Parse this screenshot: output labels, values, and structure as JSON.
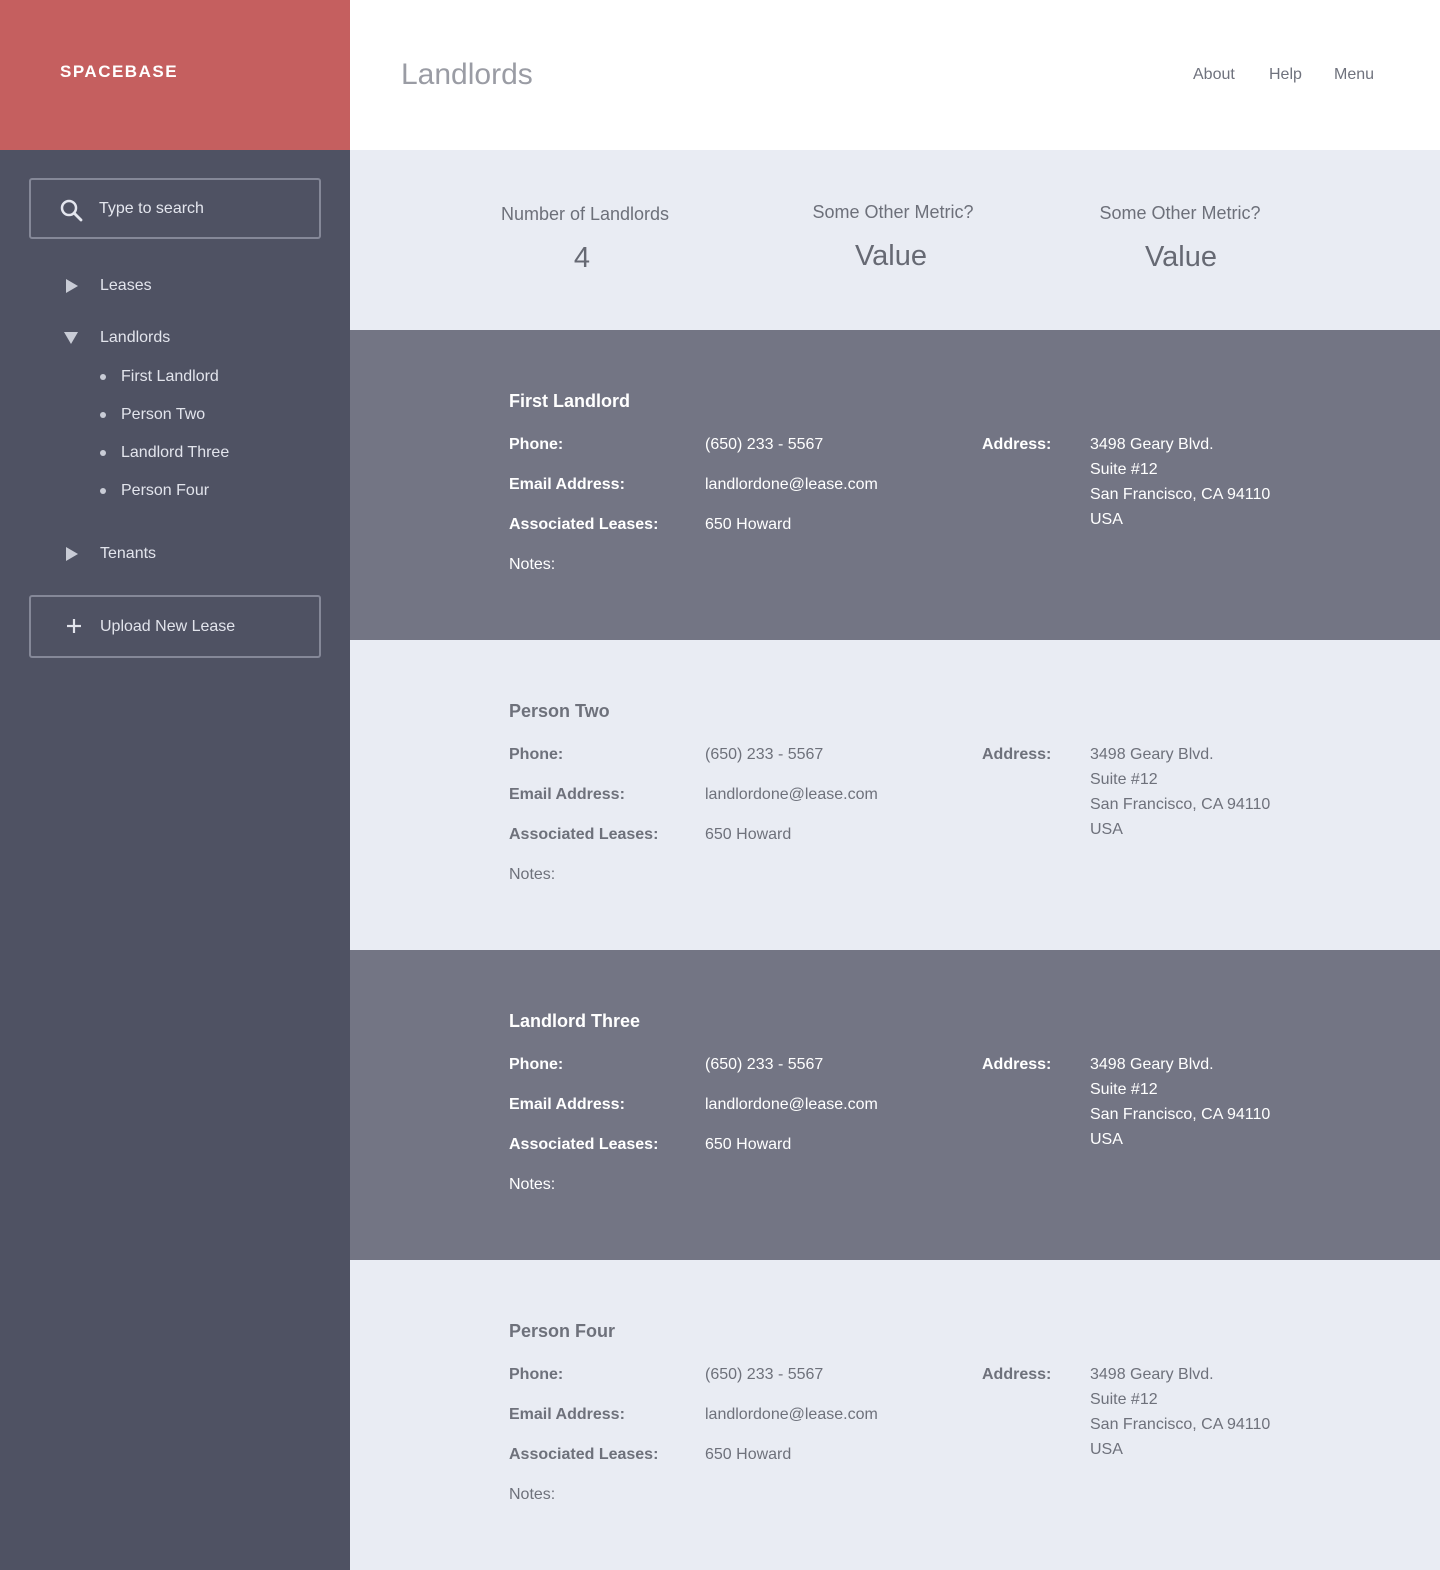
{
  "brand": {
    "name": "SPACEBASE",
    "color": "#c55f5f"
  },
  "sidebar": {
    "search_placeholder": "Type to search",
    "nav": [
      {
        "label": "Leases",
        "icon": "triangle-right-icon",
        "expanded": false
      },
      {
        "label": "Landlords",
        "icon": "triangle-down-icon",
        "expanded": true,
        "children": [
          "First Landlord",
          "Person Two",
          "Landlord Three",
          "Person Four"
        ]
      },
      {
        "label": "Tenants",
        "icon": "triangle-right-icon",
        "expanded": false
      }
    ],
    "upload_label": "Upload New Lease"
  },
  "header": {
    "title": "Landlords",
    "links": [
      "About",
      "Help",
      "Menu"
    ]
  },
  "metrics": [
    {
      "label": "Number of Landlords",
      "value": "4"
    },
    {
      "label": "Some Other Metric?",
      "value": "Value"
    },
    {
      "label": "Some Other Metric?",
      "value": "Value"
    }
  ],
  "field_labels": {
    "phone": "Phone:",
    "email": "Email Address:",
    "leases": "Associated Leases:",
    "notes": "Notes:",
    "address": "Address:"
  },
  "landlords": [
    {
      "name": "First Landlord",
      "phone": "(650) 233 - 5567",
      "email": "landlordone@lease.com",
      "leases": "650 Howard",
      "address": [
        "3498 Geary Blvd.",
        "Suite #12",
        "San Francisco, CA 94110",
        "USA"
      ]
    },
    {
      "name": "Person Two",
      "phone": "(650) 233 - 5567",
      "email": "landlordone@lease.com",
      "leases": "650 Howard",
      "address": [
        "3498 Geary Blvd.",
        "Suite #12",
        "San Francisco, CA 94110",
        "USA"
      ]
    },
    {
      "name": "Landlord Three",
      "phone": "(650) 233 - 5567",
      "email": "landlordone@lease.com",
      "leases": "650 Howard",
      "address": [
        "3498 Geary Blvd.",
        "Suite #12",
        "San Francisco, CA 94110",
        "USA"
      ]
    },
    {
      "name": "Person Four",
      "phone": "(650) 233 - 5567",
      "email": "landlordone@lease.com",
      "leases": "650 Howard",
      "address": [
        "3498 Geary Blvd.",
        "Suite #12",
        "San Francisco, CA 94110",
        "USA"
      ]
    }
  ]
}
